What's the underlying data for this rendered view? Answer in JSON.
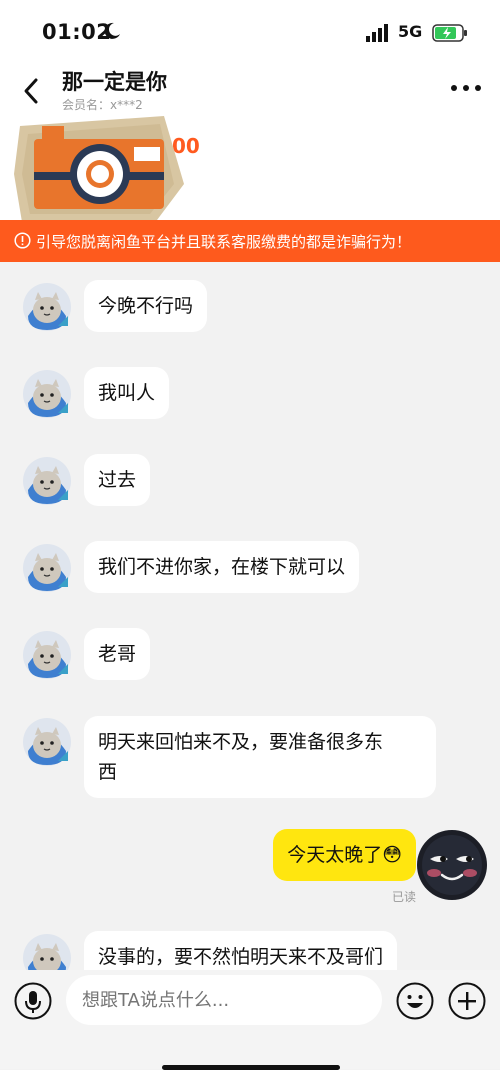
{
  "status_bar": {
    "time": "01:02",
    "network": "5G"
  },
  "header": {
    "title": "那一定是你",
    "member_label": "会员名：x***2",
    "price_fragment": "00"
  },
  "warning": {
    "text": "引导您脱离闲鱼平台并且联系客服缴费的都是诈骗行为！"
  },
  "messages": [
    {
      "side": "them",
      "text": "今晚不行吗"
    },
    {
      "side": "them",
      "text": "我叫人"
    },
    {
      "side": "them",
      "text": "过去"
    },
    {
      "side": "them",
      "text": "我们不进你家，在楼下就可以"
    },
    {
      "side": "them",
      "text": "老哥"
    },
    {
      "side": "them",
      "line1": "明天来回怕来不及，要准备很多东",
      "line2": "西"
    },
    {
      "side": "me",
      "text": "今天太晚了😳",
      "status": "已读"
    },
    {
      "side": "them",
      "text": "没事的，要不然怕明天来不及哥们"
    }
  ],
  "input": {
    "placeholder": "想跟TA说点什么..."
  },
  "colors": {
    "accent": "#ffe60f",
    "warning_bg": "#fe5a1d",
    "price": "#ff5a1f"
  }
}
